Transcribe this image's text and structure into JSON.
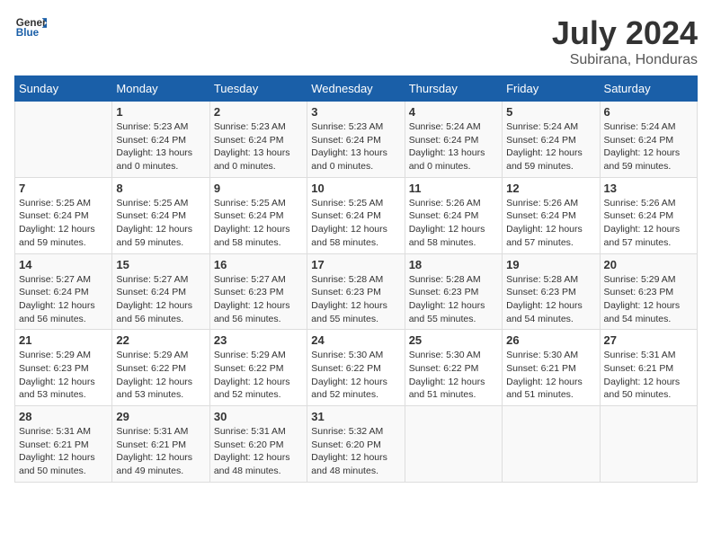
{
  "header": {
    "logo_general": "General",
    "logo_blue": "Blue",
    "month_year": "July 2024",
    "location": "Subirana, Honduras"
  },
  "days_of_week": [
    "Sunday",
    "Monday",
    "Tuesday",
    "Wednesday",
    "Thursday",
    "Friday",
    "Saturday"
  ],
  "weeks": [
    [
      {
        "day": "",
        "info": ""
      },
      {
        "day": "1",
        "info": "Sunrise: 5:23 AM\nSunset: 6:24 PM\nDaylight: 13 hours\nand 0 minutes."
      },
      {
        "day": "2",
        "info": "Sunrise: 5:23 AM\nSunset: 6:24 PM\nDaylight: 13 hours\nand 0 minutes."
      },
      {
        "day": "3",
        "info": "Sunrise: 5:23 AM\nSunset: 6:24 PM\nDaylight: 13 hours\nand 0 minutes."
      },
      {
        "day": "4",
        "info": "Sunrise: 5:24 AM\nSunset: 6:24 PM\nDaylight: 13 hours\nand 0 minutes."
      },
      {
        "day": "5",
        "info": "Sunrise: 5:24 AM\nSunset: 6:24 PM\nDaylight: 12 hours\nand 59 minutes."
      },
      {
        "day": "6",
        "info": "Sunrise: 5:24 AM\nSunset: 6:24 PM\nDaylight: 12 hours\nand 59 minutes."
      }
    ],
    [
      {
        "day": "7",
        "info": "Sunrise: 5:25 AM\nSunset: 6:24 PM\nDaylight: 12 hours\nand 59 minutes."
      },
      {
        "day": "8",
        "info": "Sunrise: 5:25 AM\nSunset: 6:24 PM\nDaylight: 12 hours\nand 59 minutes."
      },
      {
        "day": "9",
        "info": "Sunrise: 5:25 AM\nSunset: 6:24 PM\nDaylight: 12 hours\nand 58 minutes."
      },
      {
        "day": "10",
        "info": "Sunrise: 5:25 AM\nSunset: 6:24 PM\nDaylight: 12 hours\nand 58 minutes."
      },
      {
        "day": "11",
        "info": "Sunrise: 5:26 AM\nSunset: 6:24 PM\nDaylight: 12 hours\nand 58 minutes."
      },
      {
        "day": "12",
        "info": "Sunrise: 5:26 AM\nSunset: 6:24 PM\nDaylight: 12 hours\nand 57 minutes."
      },
      {
        "day": "13",
        "info": "Sunrise: 5:26 AM\nSunset: 6:24 PM\nDaylight: 12 hours\nand 57 minutes."
      }
    ],
    [
      {
        "day": "14",
        "info": "Sunrise: 5:27 AM\nSunset: 6:24 PM\nDaylight: 12 hours\nand 56 minutes."
      },
      {
        "day": "15",
        "info": "Sunrise: 5:27 AM\nSunset: 6:24 PM\nDaylight: 12 hours\nand 56 minutes."
      },
      {
        "day": "16",
        "info": "Sunrise: 5:27 AM\nSunset: 6:23 PM\nDaylight: 12 hours\nand 56 minutes."
      },
      {
        "day": "17",
        "info": "Sunrise: 5:28 AM\nSunset: 6:23 PM\nDaylight: 12 hours\nand 55 minutes."
      },
      {
        "day": "18",
        "info": "Sunrise: 5:28 AM\nSunset: 6:23 PM\nDaylight: 12 hours\nand 55 minutes."
      },
      {
        "day": "19",
        "info": "Sunrise: 5:28 AM\nSunset: 6:23 PM\nDaylight: 12 hours\nand 54 minutes."
      },
      {
        "day": "20",
        "info": "Sunrise: 5:29 AM\nSunset: 6:23 PM\nDaylight: 12 hours\nand 54 minutes."
      }
    ],
    [
      {
        "day": "21",
        "info": "Sunrise: 5:29 AM\nSunset: 6:23 PM\nDaylight: 12 hours\nand 53 minutes."
      },
      {
        "day": "22",
        "info": "Sunrise: 5:29 AM\nSunset: 6:22 PM\nDaylight: 12 hours\nand 53 minutes."
      },
      {
        "day": "23",
        "info": "Sunrise: 5:29 AM\nSunset: 6:22 PM\nDaylight: 12 hours\nand 52 minutes."
      },
      {
        "day": "24",
        "info": "Sunrise: 5:30 AM\nSunset: 6:22 PM\nDaylight: 12 hours\nand 52 minutes."
      },
      {
        "day": "25",
        "info": "Sunrise: 5:30 AM\nSunset: 6:22 PM\nDaylight: 12 hours\nand 51 minutes."
      },
      {
        "day": "26",
        "info": "Sunrise: 5:30 AM\nSunset: 6:21 PM\nDaylight: 12 hours\nand 51 minutes."
      },
      {
        "day": "27",
        "info": "Sunrise: 5:31 AM\nSunset: 6:21 PM\nDaylight: 12 hours\nand 50 minutes."
      }
    ],
    [
      {
        "day": "28",
        "info": "Sunrise: 5:31 AM\nSunset: 6:21 PM\nDaylight: 12 hours\nand 50 minutes."
      },
      {
        "day": "29",
        "info": "Sunrise: 5:31 AM\nSunset: 6:21 PM\nDaylight: 12 hours\nand 49 minutes."
      },
      {
        "day": "30",
        "info": "Sunrise: 5:31 AM\nSunset: 6:20 PM\nDaylight: 12 hours\nand 48 minutes."
      },
      {
        "day": "31",
        "info": "Sunrise: 5:32 AM\nSunset: 6:20 PM\nDaylight: 12 hours\nand 48 minutes."
      },
      {
        "day": "",
        "info": ""
      },
      {
        "day": "",
        "info": ""
      },
      {
        "day": "",
        "info": ""
      }
    ]
  ]
}
